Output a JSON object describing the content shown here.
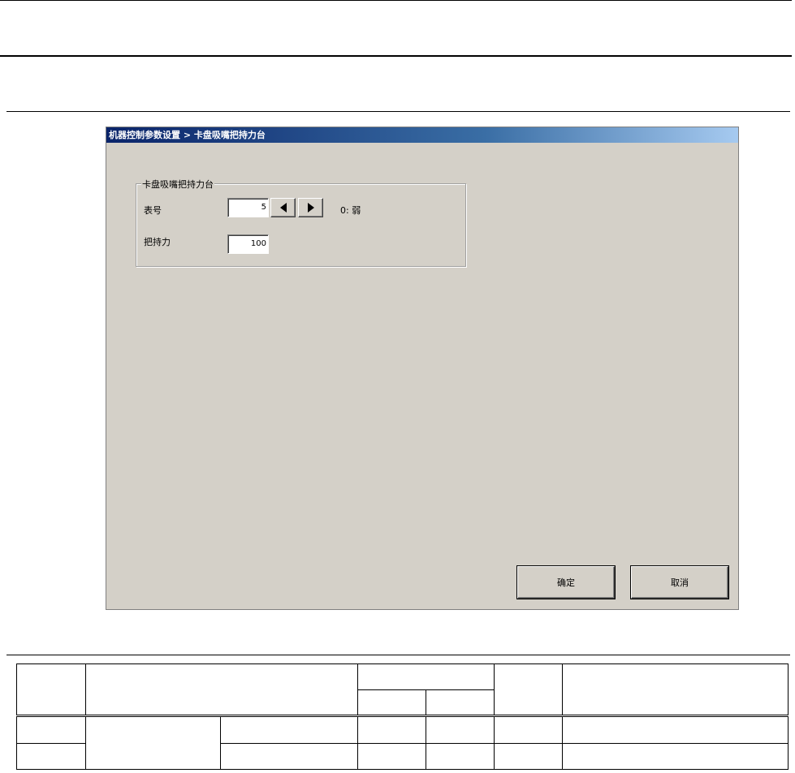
{
  "dialog": {
    "title": "机器控制参数设置 > 卡盘吸嘴把持力台",
    "group_title": "卡盘吸嘴把持力台",
    "table_no_label": "表号",
    "table_no_value": "5",
    "table_no_desc": "0: 弱",
    "grip_force_label": "把持力",
    "grip_force_value": "100",
    "ok_label": "确定",
    "cancel_label": "取消",
    "icons": {
      "prev": "triangle-left-icon",
      "next": "triangle-right-icon"
    }
  }
}
